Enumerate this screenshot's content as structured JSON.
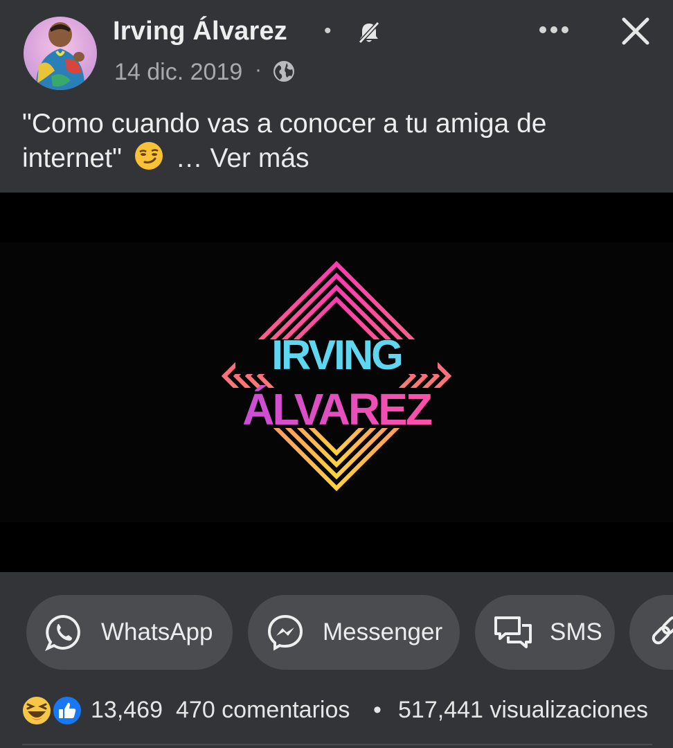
{
  "post": {
    "author": "Irving Álvarez",
    "separator": "•",
    "date": "14 dic. 2019",
    "date_separator": "·",
    "caption_line1": "\"Como cuando vas a conocer a tu amiga de",
    "caption_line2_start": "internet\"",
    "caption_more": "… Ver más"
  },
  "video": {
    "logo_line1": "IRVING",
    "logo_line2": "ÁLVAREZ"
  },
  "share": {
    "whatsapp": "WhatsApp",
    "messenger": "Messenger",
    "sms": "SMS"
  },
  "stats": {
    "reactions_count": "13,469",
    "comments": "470 comentarios",
    "dot": "•",
    "views": "517,441 visualizaciones"
  },
  "icons": [
    "avatar",
    "mute-notifications-icon",
    "more-options-icon",
    "close-icon",
    "globe-icon",
    "smirk-emoji",
    "whatsapp-icon",
    "messenger-icon",
    "sms-icon",
    "link-icon",
    "haha-reaction-icon",
    "like-reaction-icon"
  ],
  "colors": {
    "background": "#333437",
    "pill": "#4b4c4f",
    "muted_text": "#a9aaad",
    "like_blue": "#1877f2",
    "haha_yellow": "#f7c847"
  }
}
